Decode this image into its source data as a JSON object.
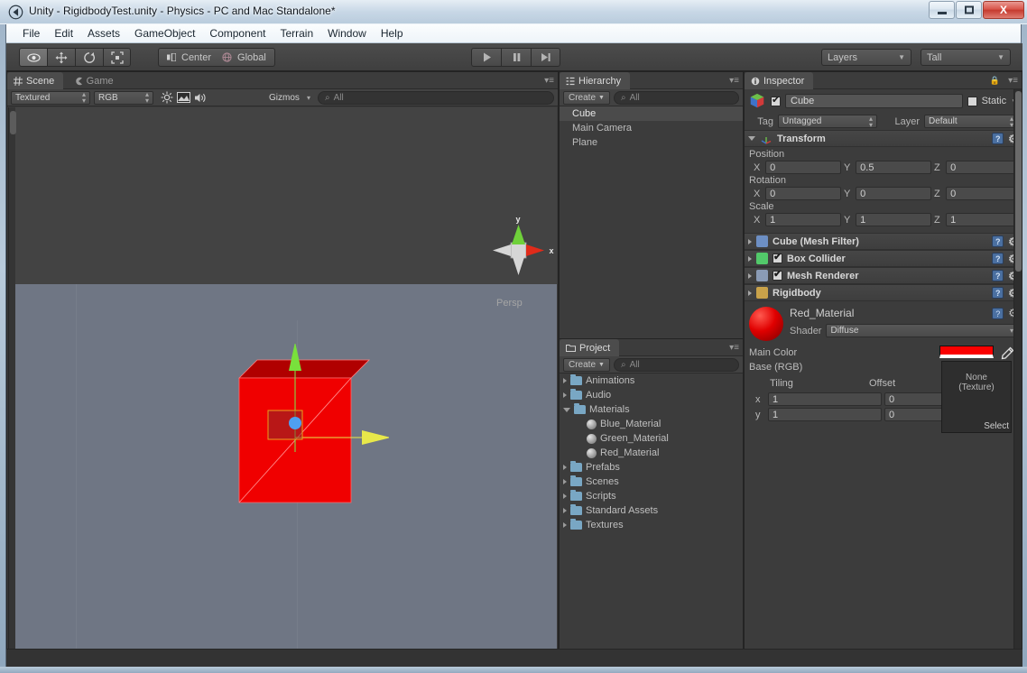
{
  "window": {
    "title": "Unity - RigidbodyTest.unity - Physics - PC and Mac Standalone*",
    "logo_icon": "unity-logo-icon",
    "minimize_label": "Minimize",
    "maximize_label": "Maximize",
    "close_label": "X"
  },
  "menu": {
    "items": [
      {
        "label": "File"
      },
      {
        "label": "Edit"
      },
      {
        "label": "Assets"
      },
      {
        "label": "GameObject"
      },
      {
        "label": "Component"
      },
      {
        "label": "Terrain"
      },
      {
        "label": "Window"
      },
      {
        "label": "Help"
      }
    ]
  },
  "toolbar": {
    "tools": [
      {
        "name": "hand-tool",
        "icon": "eye-icon",
        "active": true
      },
      {
        "name": "move-tool",
        "icon": "move-arrows-icon",
        "active": false
      },
      {
        "name": "rotate-tool",
        "icon": "rotate-icon",
        "active": false
      },
      {
        "name": "scale-tool",
        "icon": "scale-icon",
        "active": false
      }
    ],
    "pivot_label": "Center",
    "pivot_icon": "pivot-icon",
    "space_label": "Global",
    "space_icon": "globe-icon",
    "play_label": "Play",
    "pause_label": "Pause",
    "step_label": "Step",
    "layers_label": "Layers",
    "layout_label": "Tall"
  },
  "scene_panel": {
    "tabs": [
      {
        "label": "Scene",
        "icon": "scene-grid-icon",
        "active": true
      },
      {
        "label": "Game",
        "icon": "game-pacman-icon",
        "active": false
      }
    ],
    "draw_mode": "Textured",
    "render_mode": "RGB",
    "lighting_icon": "sun-icon",
    "fx_icon": "image-fx-icon",
    "audio_icon": "speaker-icon",
    "gizmos_label": "Gizmos",
    "search_placeholder": "All",
    "view_mode": "Persp",
    "gizmo_axis_x": "x",
    "gizmo_axis_y": "y"
  },
  "hierarchy": {
    "tab_label": "Hierarchy",
    "tab_icon": "hierarchy-icon",
    "create_label": "Create",
    "search_placeholder": "All",
    "items": [
      {
        "label": "Cube",
        "selected": true
      },
      {
        "label": "Main Camera",
        "selected": false
      },
      {
        "label": "Plane",
        "selected": false
      }
    ]
  },
  "project": {
    "tab_label": "Project",
    "tab_icon": "folder-icon",
    "create_label": "Create",
    "search_placeholder": "All",
    "tree": [
      {
        "label": "Animations",
        "type": "folder",
        "state": "collapsed",
        "depth": 0
      },
      {
        "label": "Audio",
        "type": "folder",
        "state": "collapsed",
        "depth": 0
      },
      {
        "label": "Materials",
        "type": "folder",
        "state": "expanded",
        "depth": 0
      },
      {
        "label": "Blue_Material",
        "type": "material",
        "state": "leaf",
        "depth": 1
      },
      {
        "label": "Green_Material",
        "type": "material",
        "state": "leaf",
        "depth": 1
      },
      {
        "label": "Red_Material",
        "type": "material",
        "state": "leaf",
        "depth": 1
      },
      {
        "label": "Prefabs",
        "type": "folder",
        "state": "collapsed",
        "depth": 0
      },
      {
        "label": "Scenes",
        "type": "folder",
        "state": "collapsed",
        "depth": 0
      },
      {
        "label": "Scripts",
        "type": "folder",
        "state": "collapsed",
        "depth": 0
      },
      {
        "label": "Standard Assets",
        "type": "folder",
        "state": "collapsed",
        "depth": 0
      },
      {
        "label": "Textures",
        "type": "folder",
        "state": "collapsed",
        "depth": 0
      }
    ]
  },
  "inspector": {
    "tab_label": "Inspector",
    "tab_icon": "info-icon",
    "lock_icon": "lock-icon",
    "object_name": "Cube",
    "object_enabled": true,
    "static_label": "Static",
    "static_checked": false,
    "tag_label": "Tag",
    "tag_value": "Untagged",
    "layer_label": "Layer",
    "layer_value": "Default",
    "transform": {
      "title": "Transform",
      "icon": "transform-axis-icon",
      "position_label": "Position",
      "rotation_label": "Rotation",
      "scale_label": "Scale",
      "axes": [
        "X",
        "Y",
        "Z"
      ],
      "position": [
        "0",
        "0.5",
        "0"
      ],
      "rotation": [
        "0",
        "0",
        "0"
      ],
      "scale": [
        "1",
        "1",
        "1"
      ]
    },
    "components": [
      {
        "label": "Cube (Mesh Filter)",
        "icon": "mesh-filter-icon",
        "has_checkbox": false,
        "checked": false
      },
      {
        "label": "Box Collider",
        "icon": "box-collider-icon",
        "has_checkbox": true,
        "checked": true
      },
      {
        "label": "Mesh Renderer",
        "icon": "mesh-renderer-icon",
        "has_checkbox": true,
        "checked": true
      },
      {
        "label": "Rigidbody",
        "icon": "rigidbody-icon",
        "has_checkbox": false,
        "checked": false
      }
    ],
    "material": {
      "name": "Red_Material",
      "shader_label": "Shader",
      "shader_value": "Diffuse",
      "main_color_label": "Main Color",
      "main_color_hex": "#fa0000",
      "eyedropper_icon": "eyedropper-icon",
      "base_rgb_label": "Base (RGB)",
      "tiling_label": "Tiling",
      "offset_label": "Offset",
      "rows": [
        {
          "axis": "x",
          "tiling": "1",
          "offset": "0"
        },
        {
          "axis": "y",
          "tiling": "1",
          "offset": "0"
        }
      ],
      "texture_none_label": "None",
      "texture_type_label": "(Texture)",
      "select_label": "Select"
    }
  },
  "theme": {
    "accent_red": "#fa0000",
    "panel_bg": "#3c3c3c",
    "toolbar_bg": "#4c4c4c",
    "sky": "#434343",
    "ground": "#6f7684"
  }
}
